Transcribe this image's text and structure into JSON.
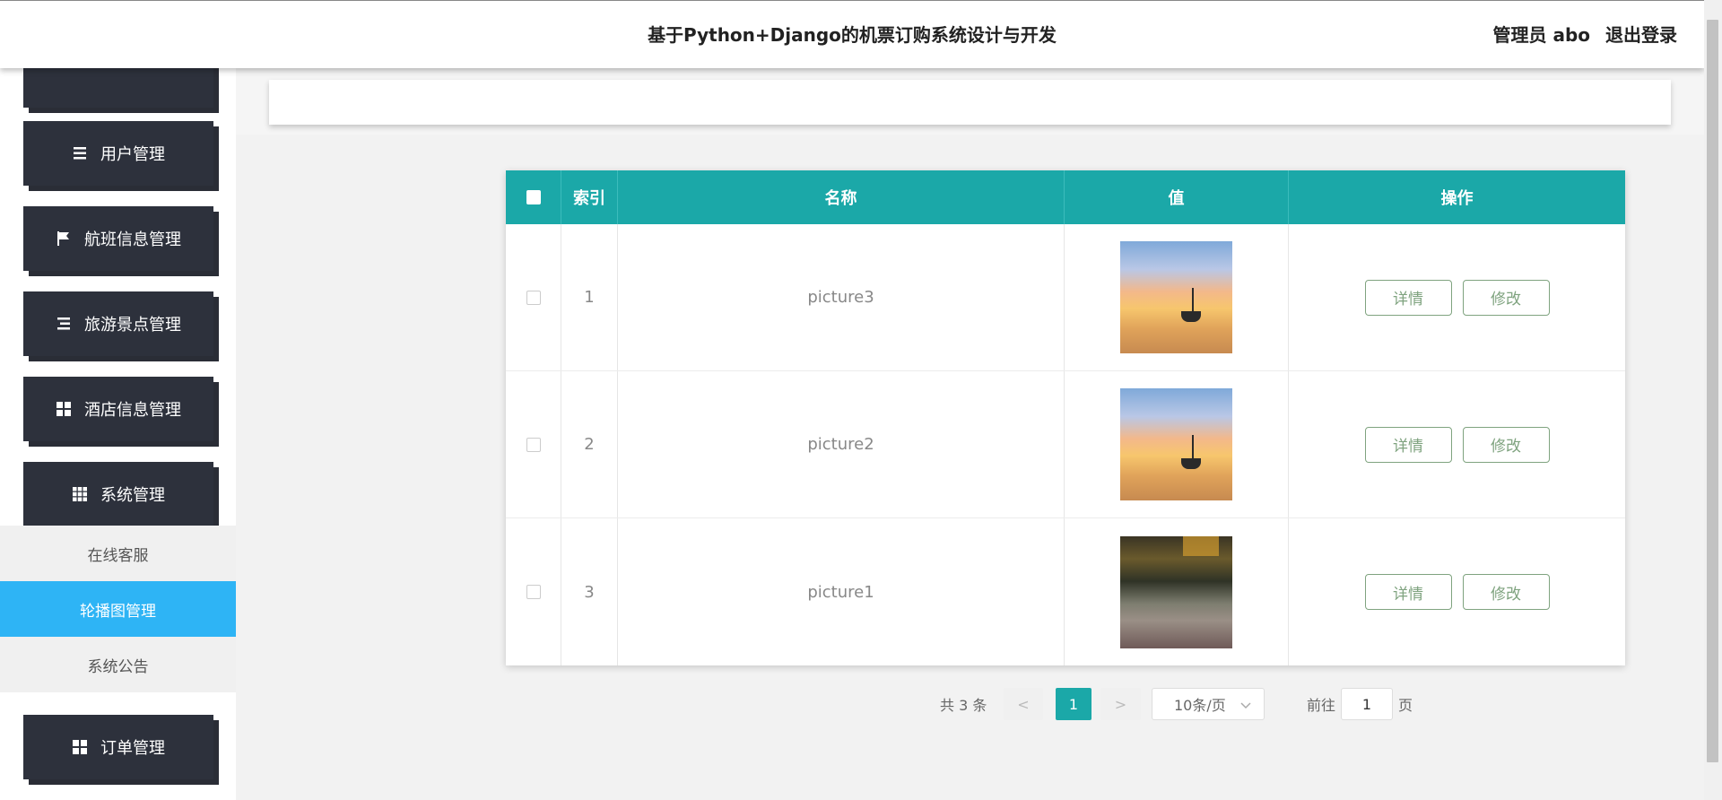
{
  "header": {
    "title": "基于Python+Django的机票订购系统设计与开发",
    "role": "管理员 abo",
    "logout": "退出登录"
  },
  "sidebar": {
    "menu": [
      {
        "label": "用户管理",
        "icon": "list-icon"
      },
      {
        "label": "航班信息管理",
        "icon": "flag-icon"
      },
      {
        "label": "旅游景点管理",
        "icon": "list-icon"
      },
      {
        "label": "酒店信息管理",
        "icon": "grid-icon"
      },
      {
        "label": "系统管理",
        "icon": "grid9-icon"
      },
      {
        "label": "订单管理",
        "icon": "grid-icon"
      }
    ],
    "submenu": [
      {
        "label": "在线客服"
      },
      {
        "label": "轮播图管理",
        "active": true
      },
      {
        "label": "系统公告"
      }
    ]
  },
  "table": {
    "headers": [
      "索引",
      "名称",
      "值",
      "操作"
    ],
    "rows": [
      {
        "index": "1",
        "name": "picture3",
        "image": "sunset-boat"
      },
      {
        "index": "2",
        "name": "picture2",
        "image": "sunset-boat"
      },
      {
        "index": "3",
        "name": "picture1",
        "image": "flower-field"
      }
    ],
    "detail_label": "详情",
    "edit_label": "修改"
  },
  "pagination": {
    "total": "共 3 条",
    "prev": "<",
    "current": "1",
    "next": ">",
    "page_size": "10条/页",
    "goto": "前往",
    "goto_value": "1",
    "page_suffix": "页"
  },
  "colors": {
    "accent": "#1ba8a8",
    "active_menu": "#2eb4f5",
    "sidebar_button": "#2d313c"
  }
}
